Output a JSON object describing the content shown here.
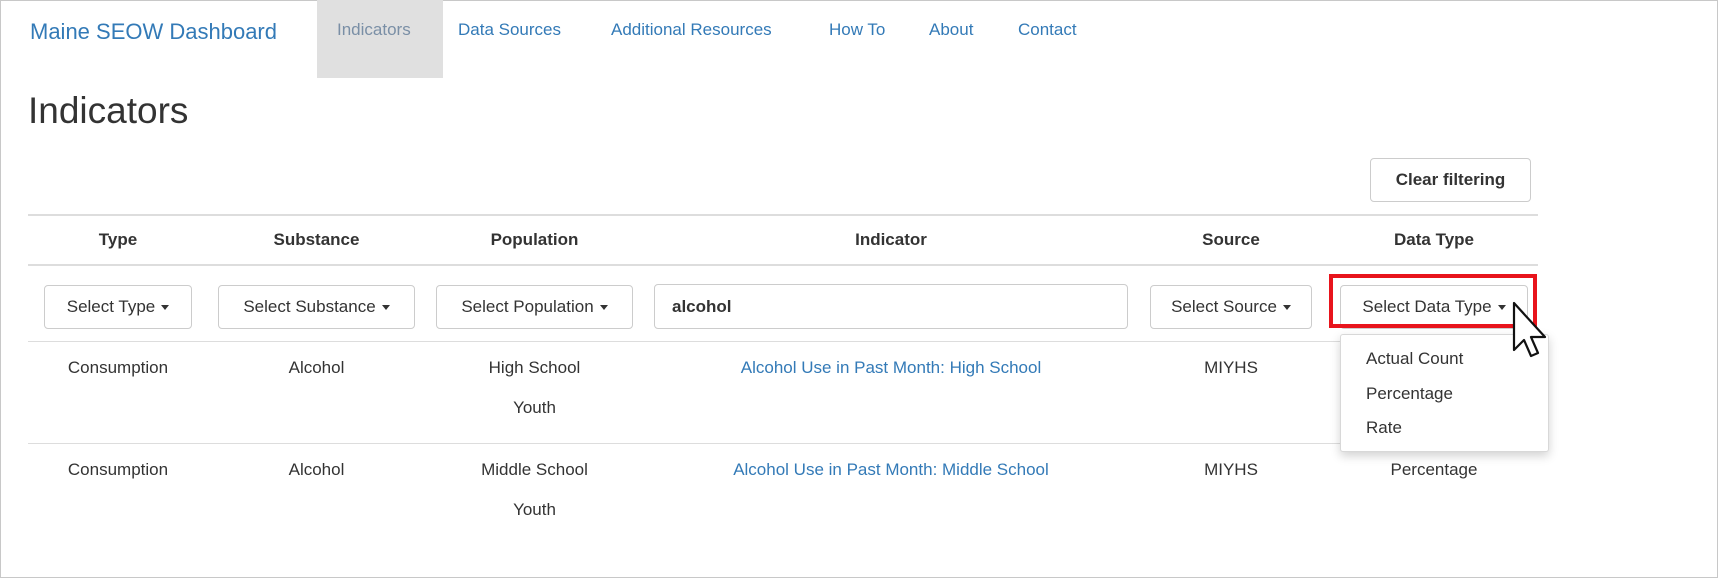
{
  "navbar": {
    "brand": "Maine SEOW Dashboard",
    "items": [
      {
        "label": "Indicators",
        "active": true
      },
      {
        "label": "Data Sources"
      },
      {
        "label": "Additional Resources"
      },
      {
        "label": "How To"
      },
      {
        "label": "About"
      },
      {
        "label": "Contact"
      }
    ]
  },
  "page": {
    "title": "Indicators"
  },
  "toolbar": {
    "clear_label": "Clear filtering"
  },
  "table": {
    "headers": [
      "Type",
      "Substance",
      "Population",
      "Indicator",
      "Source",
      "Data Type"
    ],
    "filters": {
      "type": "Select Type",
      "substance": "Select Substance",
      "population": "Select Population",
      "indicator_search": "alcohol",
      "source": "Select Source",
      "data_type": "Select Data Type"
    },
    "rows": [
      {
        "type": "Consumption",
        "substance": "Alcohol",
        "population_line1": "High School",
        "population_line2": "Youth",
        "indicator": "Alcohol Use in Past Month: High School",
        "source": "MIYHS",
        "data_type": ""
      },
      {
        "type": "Consumption",
        "substance": "Alcohol",
        "population_line1": "Middle School",
        "population_line2": "Youth",
        "indicator": "Alcohol Use in Past Month: Middle School",
        "source": "MIYHS",
        "data_type": "Percentage"
      }
    ]
  },
  "data_type_dropdown": {
    "options": [
      "Actual Count",
      "Percentage",
      "Rate"
    ]
  },
  "colors": {
    "link": "#337ab7",
    "highlight": "#e8141c",
    "active_tab_bg": "#e0e0e0"
  }
}
